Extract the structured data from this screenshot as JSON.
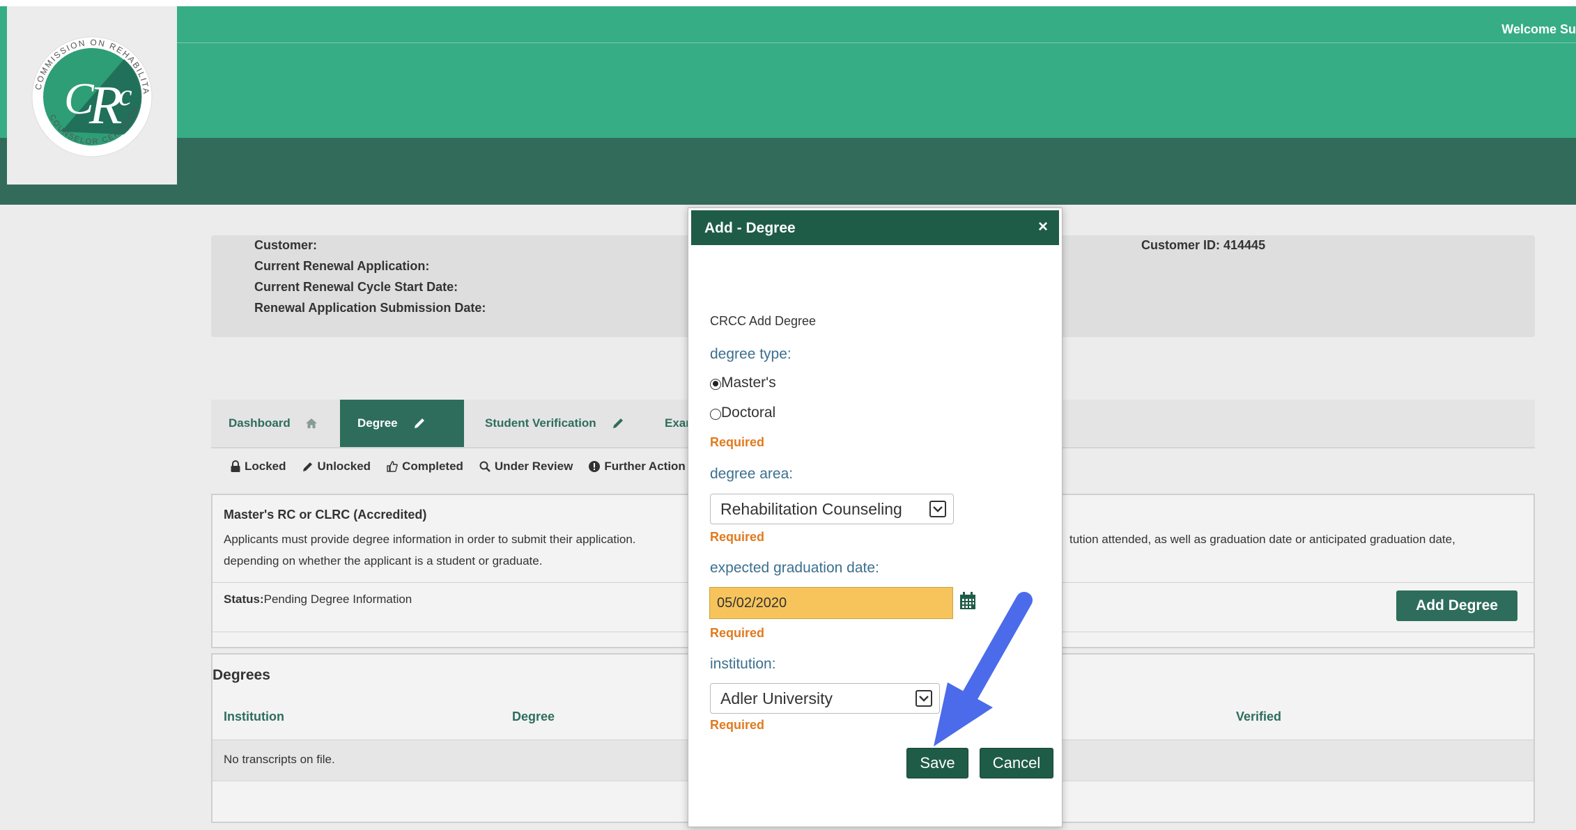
{
  "header": {
    "welcome": "Welcome Su",
    "logo_text": "COMMISSION ON REHABILITATION COUNSELOR CERTIFICATION",
    "logo_monogram": "CRC"
  },
  "info": {
    "customer_label": "Customer:",
    "renewal_app_label": "Current Renewal Application:",
    "cycle_start_label": "Current Renewal Cycle Start Date:",
    "submission_label": "Renewal Application Submission Date:",
    "customer_id": "Customer ID: 414445"
  },
  "tabs": [
    {
      "label": "Dashboard",
      "icon": "home-icon"
    },
    {
      "label": "Degree",
      "icon": "pencil-icon"
    },
    {
      "label": "Student Verification",
      "icon": "pencil-icon"
    },
    {
      "label": "Exar",
      "icon": ""
    }
  ],
  "legend": {
    "locked": "Locked",
    "unlocked": "Unlocked",
    "completed": "Completed",
    "under_review": "Under Review",
    "further_action": "Further Action"
  },
  "requirement": {
    "title": "Master's RC or CLRC (Accredited)",
    "text_left": "Applicants must provide degree information in order to submit their application.",
    "text_right": "tution attended, as well as graduation date or anticipated graduation date,",
    "text_line2": "depending on whether the applicant is a student or graduate.",
    "status_label": "Status:",
    "status_value": "Pending Degree Information",
    "add_degree": "Add Degree"
  },
  "degrees": {
    "title": "Degrees",
    "columns": [
      "Institution",
      "Degree",
      "Verified"
    ],
    "empty": "No transcripts on file."
  },
  "modal": {
    "title": "Add - Degree",
    "close": "×",
    "subtitle": "CRCC Add Degree",
    "degree_type_label": "degree type:",
    "options": [
      "Master's",
      "Doctoral"
    ],
    "selected_option": "Master's",
    "required": "Required",
    "degree_area_label": "degree area:",
    "degree_area_value": "Rehabilitation Counseling",
    "grad_date_label": "expected graduation date:",
    "grad_date_value": "05/02/2020",
    "institution_label": "institution:",
    "institution_value": "Adler University",
    "save": "Save",
    "cancel": "Cancel"
  },
  "colors": {
    "brand_green": "#37ad85",
    "dark_green": "#336b5b",
    "modal_header": "#1f5c47",
    "required_orange": "#e07a1f",
    "highlight": "#f7c45c",
    "arrow": "#4b6bea"
  }
}
